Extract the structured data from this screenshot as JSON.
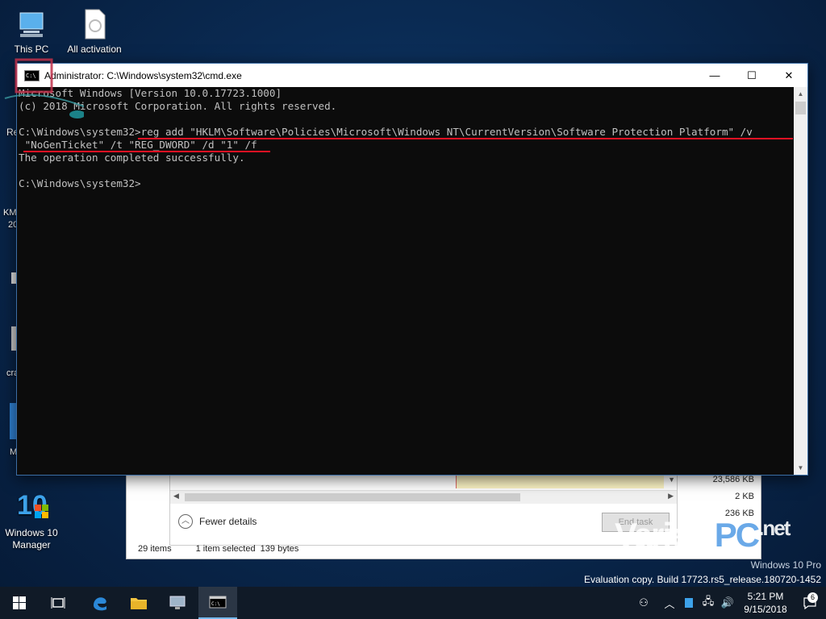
{
  "desktop": {
    "icons": [
      {
        "label": "This PC"
      },
      {
        "label": "All activation"
      },
      {
        "label": "Windows 10 Manager"
      }
    ],
    "partial_labels": [
      "Re",
      "KM",
      "20",
      "cra",
      "M"
    ]
  },
  "cmd": {
    "title": "Administrator: C:\\Windows\\system32\\cmd.exe",
    "lines": [
      "Microsoft Windows [Version 10.0.17723.1000]",
      "(c) 2018 Microsoft Corporation. All rights reserved.",
      "",
      "C:\\Windows\\system32>reg add \"HKLM\\Software\\Policies\\Microsoft\\Windows NT\\CurrentVersion\\Software Protection Platform\" /v",
      " \"NoGenTicket\" /t \"REG_DWORD\" /d \"1\" /f",
      "The operation completed successfully.",
      "",
      "C:\\Windows\\system32>"
    ],
    "buttons": {
      "minimize": "—",
      "maximize": "☐",
      "close": "✕"
    }
  },
  "background_window": {
    "sizes": [
      "23,586 KB",
      "2 KB",
      "236 KB"
    ],
    "fewer_details": "Fewer details",
    "end_task": "End task",
    "status_items": "29 items",
    "status_selected": "1 item selected  139 bytes"
  },
  "watermark": {
    "brand_a": "Variety",
    "brand_b": "PC",
    "brand_c": ".net",
    "edition": "Windows 10 Pro",
    "eval": "Evaluation copy. Build 17723.rs5_release.180720-1452"
  },
  "taskbar": {
    "time": "5:21 PM",
    "date": "9/15/2018",
    "notifications": "6"
  },
  "colors": {
    "underline": "#e81123",
    "cmd_bg": "#0c0c0c",
    "cmd_text": "#c0c0c0",
    "taskbar_bg": "#101a27"
  }
}
